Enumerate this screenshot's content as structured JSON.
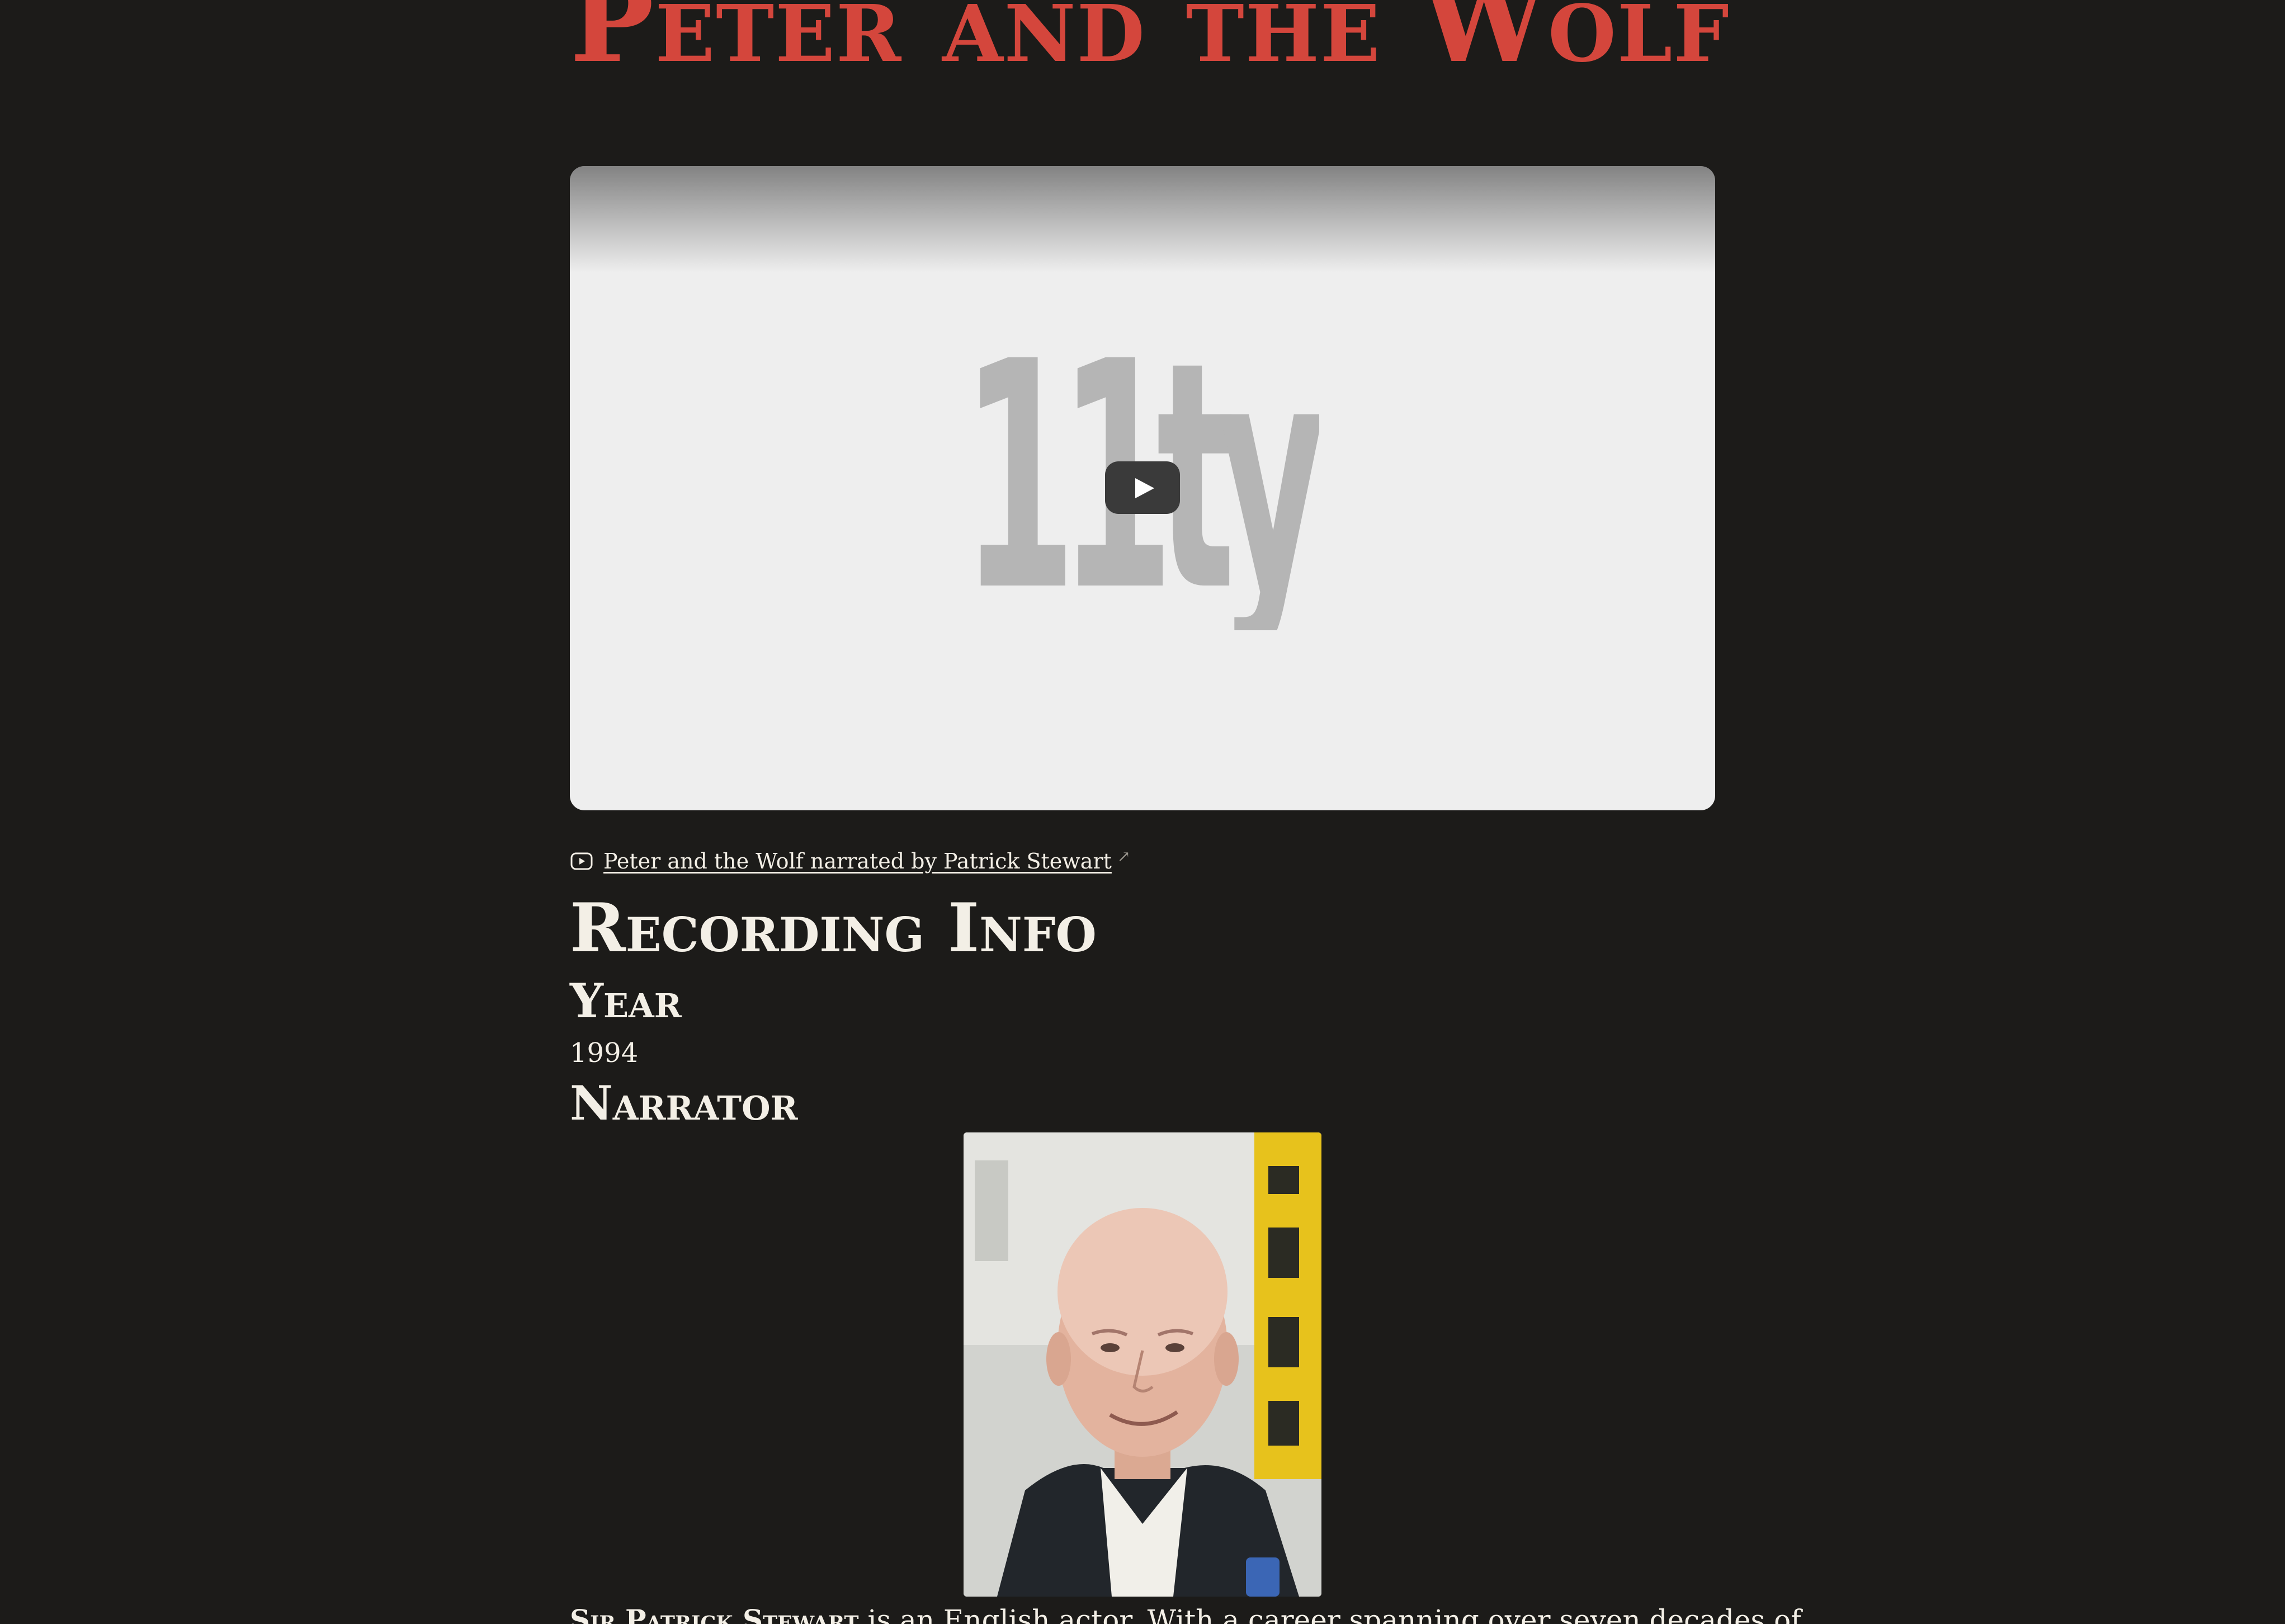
{
  "page": {
    "title": "Peter and the Wolf"
  },
  "video": {
    "logo_text": "11ty",
    "play_label": "Play",
    "link_text": "Peter and the Wolf narrated by Patrick Stewart",
    "external_mark": "↗"
  },
  "recording_info": {
    "heading": "Recording Info",
    "year_heading": "Year",
    "year_value": "1994",
    "narrator_heading": "Narrator"
  },
  "bio": {
    "name": "Sir Patrick Stewart",
    "text": " is an English actor. With a career spanning over seven decades of"
  },
  "colors": {
    "background": "#1c1b19",
    "title": "#d4463c",
    "text": "#f3efe6"
  }
}
